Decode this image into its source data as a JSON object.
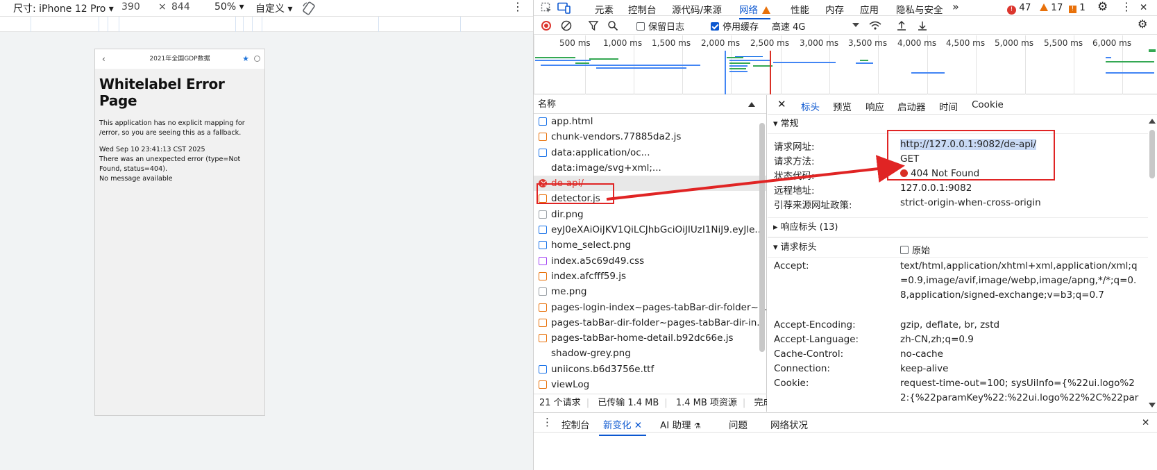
{
  "device_toolbar": {
    "dimensions_label": "尺寸: iPhone 12 Pro ▾",
    "width": "390",
    "times": "×",
    "height": "844",
    "zoom": "50% ▾",
    "throttle": "自定义 ▾",
    "more": "⋮"
  },
  "phone": {
    "nav_title": "2021年全国GDP数据",
    "back": "‹",
    "star": "★",
    "error_title": "Whitelabel Error Page",
    "line1": "This application has no explicit mapping for /error, so you are seeing this as a fallback.",
    "line2": "Wed Sep 10 23:41:13 CST 2025",
    "line3": "There was an unexpected error (type=Not Found, status=404).",
    "line4": "No message available"
  },
  "devtools_tabs": {
    "elements": "元素",
    "console": "控制台",
    "sources": "源代码/来源",
    "network": "网络",
    "performance": "性能",
    "memory": "内存",
    "application": "应用",
    "privacy": "隐私与安全",
    "more": "»",
    "errors": "47",
    "warnings": "17",
    "issues": "1",
    "settings": "⚙",
    "kebab": "⋮",
    "close": "✕"
  },
  "net_toolbar": {
    "preserve_log": "保留日志",
    "disable_cache": "停用缓存",
    "throttle": "高速 4G"
  },
  "timeline": {
    "ticks": [
      "500 ms",
      "1,000 ms",
      "1,500 ms",
      "2,000 ms",
      "2,500 ms",
      "3,000 ms",
      "3,500 ms",
      "4,000 ms",
      "4,500 ms",
      "5,000 ms",
      "5,500 ms",
      "6,000 ms"
    ]
  },
  "request_list": {
    "header": "名称",
    "rows": [
      {
        "name": "app.html",
        "type": "doc"
      },
      {
        "name": "chunk-vendors.77885da2.js",
        "type": "js"
      },
      {
        "name": "data:application/oc...",
        "type": "font"
      },
      {
        "name": "data:image/svg+xml;...",
        "type": "img"
      },
      {
        "name": "de-api/",
        "type": "err"
      },
      {
        "name": "detector.js",
        "type": "js"
      },
      {
        "name": "dir.png",
        "type": "img"
      },
      {
        "name": "eyJ0eXAiOiJKV1QiLCJhbGciOiJIUzI1NiJ9.eyJle...",
        "type": "doc"
      },
      {
        "name": "home_select.png",
        "type": "img"
      },
      {
        "name": "index.a5c69d49.css",
        "type": "css"
      },
      {
        "name": "index.afcfff59.js",
        "type": "js"
      },
      {
        "name": "me.png",
        "type": "img"
      },
      {
        "name": "pages-login-index~pages-tabBar-dir-folder~...",
        "type": "js"
      },
      {
        "name": "pages-tabBar-dir-folder~pages-tabBar-dir-in...",
        "type": "js"
      },
      {
        "name": "pages-tabBar-home-detail.b92dc66e.js",
        "type": "js"
      },
      {
        "name": "shadow-grey.png",
        "type": "img"
      },
      {
        "name": "uniicons.b6d3756e.ttf",
        "type": "font"
      },
      {
        "name": "viewLog",
        "type": "js"
      }
    ],
    "status": {
      "requests": "21 个请求",
      "transferred": "已传输 1.4 MB",
      "resources": "1.4 MB 项资源",
      "finish": "完成用"
    }
  },
  "headers_panel": {
    "tabs": {
      "close": "✕",
      "headers": "标头",
      "preview": "预览",
      "response": "响应",
      "initiator": "启动器",
      "timing": "时间",
      "cookie": "Cookie"
    },
    "general_title": "▾ 常规",
    "general": {
      "url_key": "请求网址:",
      "url_val": "http://127.0.0.1:9082/de-api/",
      "method_key": "请求方法:",
      "method_val": "GET",
      "status_key": "状态代码:",
      "status_val": "404 Not Found",
      "remote_key": "远程地址:",
      "remote_val": "127.0.0.1:9082",
      "referrer_key": "引荐来源网址政策:",
      "referrer_val": "strict-origin-when-cross-origin"
    },
    "response_headers_title": "▸ 响应标头 (13)",
    "request_headers_title": "▾ 请求标头",
    "raw_label": "原始",
    "request_headers": {
      "accept_key": "Accept:",
      "accept_val": "text/html,application/xhtml+xml,application/xml;q=0.9,image/avif,image/webp,image/apng,*/*;q=0.8,application/signed-exchange;v=b3;q=0.7",
      "encoding_key": "Accept-Encoding:",
      "encoding_val": "gzip, deflate, br, zstd",
      "language_key": "Accept-Language:",
      "language_val": "zh-CN,zh;q=0.9",
      "cache_key": "Cache-Control:",
      "cache_val": "no-cache",
      "connection_key": "Connection:",
      "connection_val": "keep-alive",
      "cookie_key": "Cookie:",
      "cookie_val": "request-time-out=100; sysUiInfo={%22ui.logo%22:{%22paramKey%22:%22ui.logo%22%2C%22par"
    }
  },
  "drawer": {
    "kebab": "⋮",
    "console": "控制台",
    "whats_new": "新变化",
    "ai": "AI 助理",
    "issues": "问题",
    "network_conditions": "网络状况",
    "close": "✕"
  },
  "colors": {
    "accent": "#0b57d0",
    "error": "#dc362e",
    "annotation": "#e02424"
  }
}
